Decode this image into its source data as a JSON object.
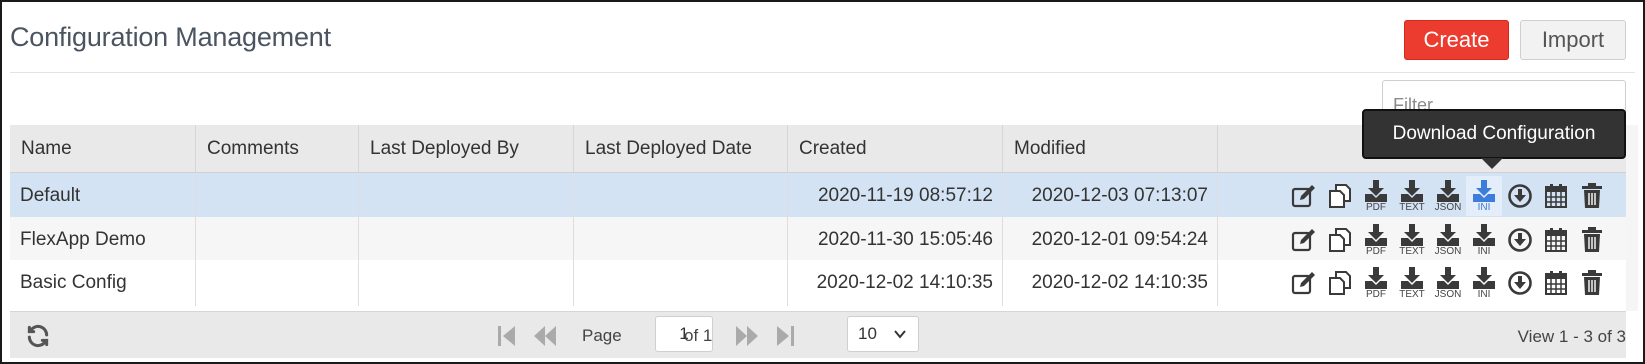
{
  "page": {
    "title": "Configuration Management"
  },
  "toolbar": {
    "create_label": "Create",
    "import_label": "Import",
    "filter_placeholder": "Filter"
  },
  "columns": [
    "Name",
    "Comments",
    "Last Deployed By",
    "Last Deployed Date",
    "Created",
    "Modified"
  ],
  "rows": [
    {
      "name": "Default",
      "comments": "",
      "last_deployed_by": "",
      "last_deployed_date": "",
      "created": "2020-11-19 08:57:12",
      "modified": "2020-12-03 07:13:07",
      "selected": true
    },
    {
      "name": "FlexApp Demo",
      "comments": "",
      "last_deployed_by": "",
      "last_deployed_date": "",
      "created": "2020-11-30 15:05:46",
      "modified": "2020-12-01 09:54:24",
      "selected": false
    },
    {
      "name": "Basic Config",
      "comments": "",
      "last_deployed_by": "",
      "last_deployed_date": "",
      "created": "2020-12-02 14:10:35",
      "modified": "2020-12-02 14:10:35",
      "selected": false
    }
  ],
  "row_actions": [
    {
      "icon": "edit-icon",
      "label": ""
    },
    {
      "icon": "copy-icon",
      "label": ""
    },
    {
      "icon": "download-icon",
      "label": "PDF"
    },
    {
      "icon": "download-icon",
      "label": "TEXT"
    },
    {
      "icon": "download-icon",
      "label": "JSON"
    },
    {
      "icon": "download-icon",
      "label": "INI"
    },
    {
      "icon": "deploy-icon",
      "label": ""
    },
    {
      "icon": "calendar-icon",
      "label": ""
    },
    {
      "icon": "trash-icon",
      "label": ""
    }
  ],
  "tooltip": {
    "text": "Download Configuration"
  },
  "pager": {
    "page_label": "Page",
    "page_value": "1",
    "of_label": "of 1",
    "page_size": "10",
    "view_text": "View 1 - 3 of 3"
  },
  "colors": {
    "create": "#ec3b2f",
    "selected_row": "#d3e3f4",
    "highlight": "#3b7dd8"
  }
}
